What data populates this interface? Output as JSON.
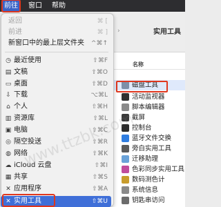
{
  "menubar": {
    "items": [
      {
        "label": "前往",
        "active": true
      },
      {
        "label": "窗口"
      },
      {
        "label": "帮助"
      }
    ]
  },
  "menu": {
    "top_items": [
      {
        "label": "返回",
        "shortcut": "⌘ [",
        "disabled": true
      },
      {
        "label": "前进",
        "shortcut": "⌘ ]",
        "disabled": true
      },
      {
        "label": "新窗口中的最上层文件夹",
        "shortcut": "^⌘↑",
        "disabled": false
      }
    ],
    "places": [
      {
        "label": "最近使用",
        "shortcut": "⇧⌘F",
        "icon": "clock-icon"
      },
      {
        "label": "文稿",
        "shortcut": "⇧⌘O",
        "icon": "document-icon"
      },
      {
        "label": "桌面",
        "shortcut": "⇧⌘D",
        "icon": "desktop-icon"
      },
      {
        "label": "下载",
        "shortcut": "⌥⌘L",
        "icon": "download-icon"
      },
      {
        "label": "个人",
        "shortcut": "⇧⌘H",
        "icon": "home-icon"
      },
      {
        "label": "资源库",
        "shortcut": "⇧⌘L",
        "icon": "library-icon"
      },
      {
        "label": "电脑",
        "shortcut": "⇧⌘C",
        "icon": "computer-icon"
      },
      {
        "label": "隔空投送",
        "shortcut": "⇧⌘R",
        "icon": "airdrop-icon"
      },
      {
        "label": "网络",
        "shortcut": "⇧⌘K",
        "icon": "network-icon"
      },
      {
        "label": "iCloud 云盘",
        "shortcut": "⇧⌘I",
        "icon": "cloud-icon"
      },
      {
        "label": "共享",
        "shortcut": "⇧⌘S",
        "icon": "shared-icon"
      },
      {
        "label": "应用程序",
        "shortcut": "⇧⌘A",
        "icon": "applications-icon"
      },
      {
        "label": "实用工具",
        "shortcut": "⇧⌘U",
        "icon": "utilities-icon",
        "highlighted": true
      }
    ]
  },
  "finder": {
    "title": "实用工具",
    "column_header": "名称",
    "files": [
      {
        "name": "磁盘工具",
        "color": "#7d8fa8",
        "selected": true
      },
      {
        "name": "活动监视器",
        "color": "#2f2f2f"
      },
      {
        "name": "脚本编辑器",
        "color": "#8a8a8a"
      },
      {
        "name": "截屏",
        "color": "#3b3b3b"
      },
      {
        "name": "控制台",
        "color": "#2b2b2b"
      },
      {
        "name": "蓝牙文件交换",
        "color": "#2f7de0"
      },
      {
        "name": "旁白实用工具",
        "color": "#5a5a5a"
      },
      {
        "name": "迁移助理",
        "color": "#6aa2d8"
      },
      {
        "name": "色彩同步实用工具",
        "color": "#c04c9c"
      },
      {
        "name": "数码测色计",
        "color": "#c89c2c"
      },
      {
        "name": "系统信息",
        "color": "#8a8a8a"
      },
      {
        "name": "钥匙串访问",
        "color": "#6c6c6c"
      }
    ]
  },
  "watermark": "www.ttzbk.com",
  "colors": {
    "highlight": "#3f6fd8",
    "callout": "#e0361d"
  }
}
